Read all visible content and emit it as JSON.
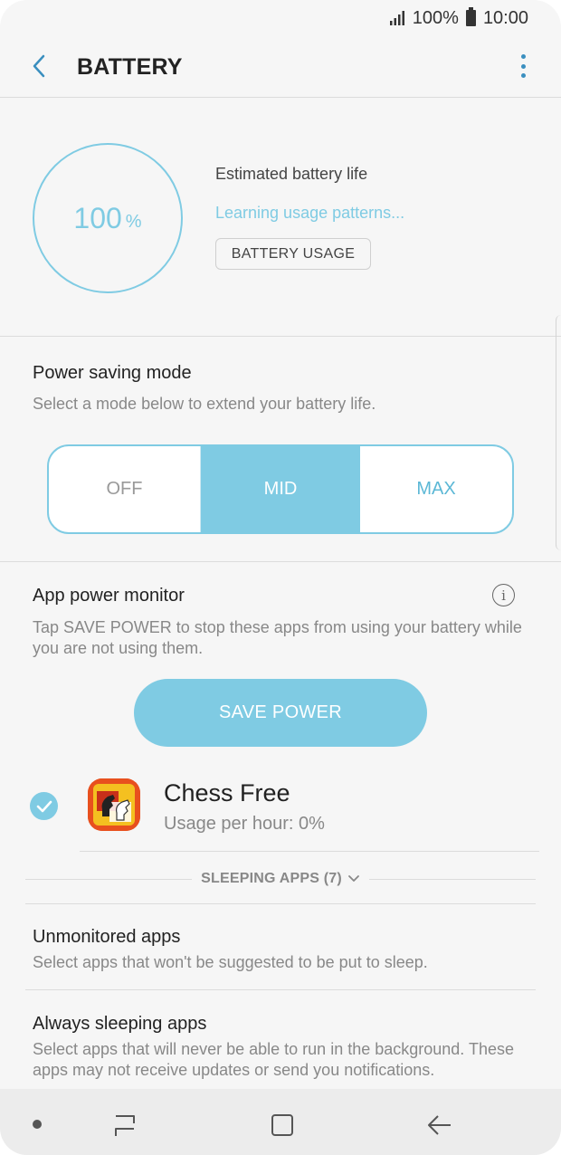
{
  "status_bar": {
    "battery_percent": "100%",
    "time": "10:00"
  },
  "header": {
    "title": "BATTERY"
  },
  "battery": {
    "percent_value": "100",
    "percent_unit": "%",
    "estimated_label": "Estimated battery life",
    "learning_text": "Learning usage patterns...",
    "usage_button": "BATTERY USAGE"
  },
  "power_saving": {
    "title": "Power saving mode",
    "description": "Select a mode below to extend your battery life.",
    "modes": [
      "OFF",
      "MID",
      "MAX"
    ],
    "selected": "MID"
  },
  "app_power_monitor": {
    "title": "App power monitor",
    "description": "Tap SAVE POWER to stop these apps from using your battery while you are not using them.",
    "save_button": "SAVE POWER",
    "apps": [
      {
        "name": "Chess Free",
        "usage": "Usage per hour: 0%",
        "checked": true
      }
    ],
    "sleeping_label": "SLEEPING APPS (7)"
  },
  "unmonitored": {
    "title": "Unmonitored apps",
    "description": "Select apps that won't be suggested to be put to sleep."
  },
  "always_sleeping": {
    "title": "Always sleeping apps",
    "description": "Select apps that will never be able to run in the background. These apps may not receive updates or send you notifications."
  },
  "colors": {
    "accent": "#7fcbe3",
    "accent_dark": "#3a8fbf",
    "background": "#f6f6f6"
  }
}
